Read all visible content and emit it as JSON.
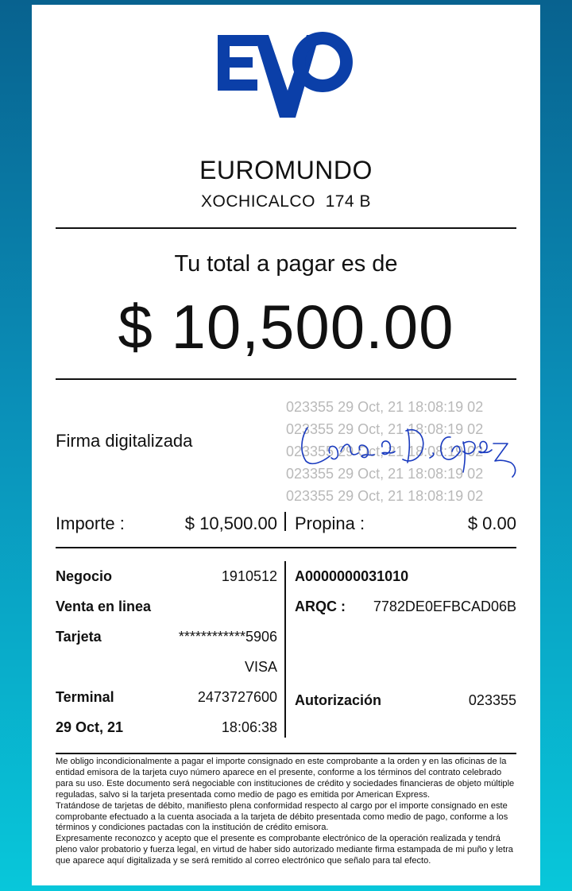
{
  "brand": {
    "logo_text": "EVO",
    "color": "#0b3fa8"
  },
  "merchant": {
    "name": "EUROMUNDO",
    "address": "XOCHICALCO  174 B"
  },
  "total": {
    "label": "Tu total a pagar es de",
    "amount": "$ 10,500.00"
  },
  "signature": {
    "label": "Firma digitalizada",
    "watermark_lines": [
      "023355 29 Oct, 21 18:08:19 02",
      "023355 29 Oct, 21 18:08:19 02",
      "023355 29 Oct, 21 18:08:19 02",
      "023355 29 Oct, 21 18:08:19 02",
      "023355 29 Oct, 21 18:08:19 02"
    ]
  },
  "amounts": {
    "importe_label": "Importe :",
    "importe_value": "$ 10,500.00",
    "propina_label": "Propina :",
    "propina_value": "$ 0.00"
  },
  "details": {
    "negocio_label": "Negocio",
    "negocio_value": "1910512",
    "venta_label": "Venta en linea",
    "tarjeta_label": "Tarjeta",
    "tarjeta_value": "************5906",
    "card_brand": "VISA",
    "terminal_label": "Terminal",
    "terminal_value": "2473727600",
    "date": "29 Oct, 21",
    "time": "18:06:38",
    "aid": "A0000000031010",
    "arqc_label": "ARQC :",
    "arqc_value": "7782DE0EFBCAD06B",
    "auth_label": "Autorización",
    "auth_value": "023355"
  },
  "legal": {
    "p1": "Me obligo incondicionalmente a pagar el importe consignado en este comprobante a la orden y en las oficinas de la entidad emisora de la tarjeta cuyo número aparece en el presente, conforme a los términos del contrato celebrado para su uso. Este documento será negociable con instituciones de crédito y sociedades financieras de objeto múltiple reguladas, salvo si la tarjeta presentada como medio de pago es emitida por American Express.",
    "p2": "Tratándose de tarjetas de débito, manifiesto plena conformidad respecto al cargo por el importe consignado en este comprobante efectuado a la cuenta asociada a la tarjeta de débito presentada como medio de pago, conforme a los términos y condiciones pactadas con la institución de crédito emisora.",
    "p3": "Expresamente reconozco y acepto que el presente es comprobante electrónico de la operación realizada y tendrá pleno valor probatorio y fuerza legal, en virtud de haber sido autorizado mediante firma estampada de mi puño y letra que aparece aquí digitalizada y se será remitido al correo electrónico que señalo para tal efecto."
  }
}
